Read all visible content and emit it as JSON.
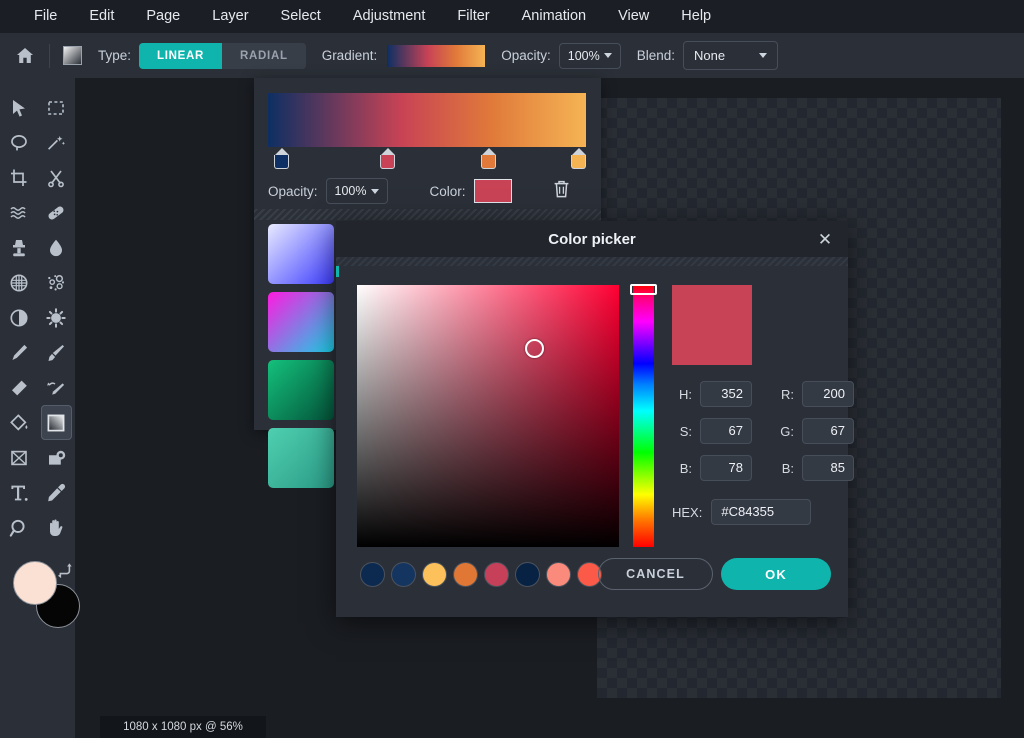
{
  "menubar": {
    "items": [
      {
        "label": "File"
      },
      {
        "label": "Edit"
      },
      {
        "label": "Page"
      },
      {
        "label": "Layer"
      },
      {
        "label": "Select"
      },
      {
        "label": "Adjustment"
      },
      {
        "label": "Filter"
      },
      {
        "label": "Animation"
      },
      {
        "label": "View"
      },
      {
        "label": "Help"
      }
    ]
  },
  "optionbar": {
    "home_icon": "home-icon",
    "tool_icon": "gradient-swatch-icon",
    "type_label": "Type:",
    "type_linear": "LINEAR",
    "type_radial": "RADIAL",
    "type_selected": "LINEAR",
    "gradient_label": "Gradient:",
    "opacity_label": "Opacity:",
    "opacity_value": "100%",
    "blend_label": "Blend:",
    "blend_value": "None"
  },
  "toolbar": {
    "tools": [
      {
        "name": "move-tool",
        "icon": "cursor-arrow-icon"
      },
      {
        "name": "marquee-select-tool",
        "icon": "dashed-rectangle-icon"
      },
      {
        "name": "lasso-tool",
        "icon": "lasso-icon"
      },
      {
        "name": "magic-wand-tool",
        "icon": "magic-wand-icon"
      },
      {
        "name": "crop-tool",
        "icon": "crop-icon"
      },
      {
        "name": "scissors-tool",
        "icon": "scissors-icon"
      },
      {
        "name": "liquify-tool",
        "icon": "wave-lines-icon"
      },
      {
        "name": "healing-tool",
        "icon": "bandage-icon"
      },
      {
        "name": "clone-stamp-tool",
        "icon": "stamp-icon"
      },
      {
        "name": "blur-tool",
        "icon": "water-drop-icon"
      },
      {
        "name": "mesh-warp-tool",
        "icon": "globe-grid-icon"
      },
      {
        "name": "particles-tool",
        "icon": "bokeh-dots-icon"
      },
      {
        "name": "contrast-tool",
        "icon": "half-circle-icon"
      },
      {
        "name": "effects-tool",
        "icon": "gear-sun-icon"
      },
      {
        "name": "pen-tool",
        "icon": "pen-icon"
      },
      {
        "name": "paintbrush-tool",
        "icon": "paintbrush-icon"
      },
      {
        "name": "eraser-tool",
        "icon": "eraser-icon"
      },
      {
        "name": "smudge-tool",
        "icon": "smudge-brush-icon"
      },
      {
        "name": "paint-bucket-tool",
        "icon": "paint-bucket-icon"
      },
      {
        "name": "gradient-tool",
        "icon": "gradient-square-icon"
      },
      {
        "name": "transform-tool",
        "icon": "crossed-box-icon"
      },
      {
        "name": "shape-tool",
        "icon": "rounded-shape-icon"
      },
      {
        "name": "text-tool",
        "icon": "text-t-icon"
      },
      {
        "name": "eyedropper-tool",
        "icon": "eyedropper-icon"
      },
      {
        "name": "zoom-tool",
        "icon": "magnifier-icon"
      },
      {
        "name": "hand-tool",
        "icon": "hand-icon"
      }
    ],
    "selected_tool": "gradient-tool",
    "foreground_color": "#FBE0D4",
    "background_color": "#050505",
    "swap_icon": "swap-colors-icon"
  },
  "canvas": {
    "status_text": "1080 x 1080 px @ 56%"
  },
  "gradient_panel": {
    "stops": [
      {
        "position": 0,
        "color": "#0D2F63"
      },
      {
        "position": 42,
        "color": "#C84355"
      },
      {
        "position": 70,
        "color": "#E0793A"
      },
      {
        "position": 100,
        "color": "#F5B454"
      }
    ],
    "selected_stop_index": 1,
    "opacity_label": "Opacity:",
    "opacity_value": "100%",
    "color_label": "Color:",
    "color_value": "#C84355",
    "delete_icon": "trash-icon",
    "presets": [
      {
        "name": "preset-blue-violet",
        "css": "linear-gradient(135deg,#e8eaff 0%,#3d3dff 100%)"
      },
      {
        "name": "preset-magenta-cyan",
        "css": "linear-gradient(135deg,#ff1ae0 0%,#18d3e8 100%)"
      },
      {
        "name": "preset-green",
        "css": "linear-gradient(135deg,#14c07c 0%,#04543a 100%)"
      },
      {
        "name": "preset-teal",
        "css": "linear-gradient(135deg,#4fd0b0 0%,#2b9a86 100%)"
      }
    ]
  },
  "color_picker": {
    "title": "Color picker",
    "close_icon": "close-icon",
    "preview_color": "#C84355",
    "hue_base": "#FF0033",
    "fields": {
      "h_label": "H:",
      "h_value": "352",
      "s_label": "S:",
      "s_value": "67",
      "b_label": "B:",
      "b_value": "78",
      "r_label": "R:",
      "r_value": "200",
      "g_label": "G:",
      "g_value": "67",
      "b2_label": "B:",
      "b2_value": "85"
    },
    "hex_label": "HEX:",
    "hex_value": "#C84355",
    "swatches": [
      {
        "name": "swatch-navy-dark",
        "color": "#0C2A50"
      },
      {
        "name": "swatch-navy",
        "color": "#153561"
      },
      {
        "name": "swatch-amber",
        "color": "#FCC15B"
      },
      {
        "name": "swatch-orange",
        "color": "#E07734"
      },
      {
        "name": "swatch-crimson",
        "color": "#C64059"
      },
      {
        "name": "swatch-midnight",
        "color": "#082244"
      },
      {
        "name": "swatch-salmon",
        "color": "#F98A7C"
      },
      {
        "name": "swatch-coral",
        "color": "#FA5A47"
      }
    ],
    "cancel_label": "CANCEL",
    "ok_label": "OK"
  }
}
